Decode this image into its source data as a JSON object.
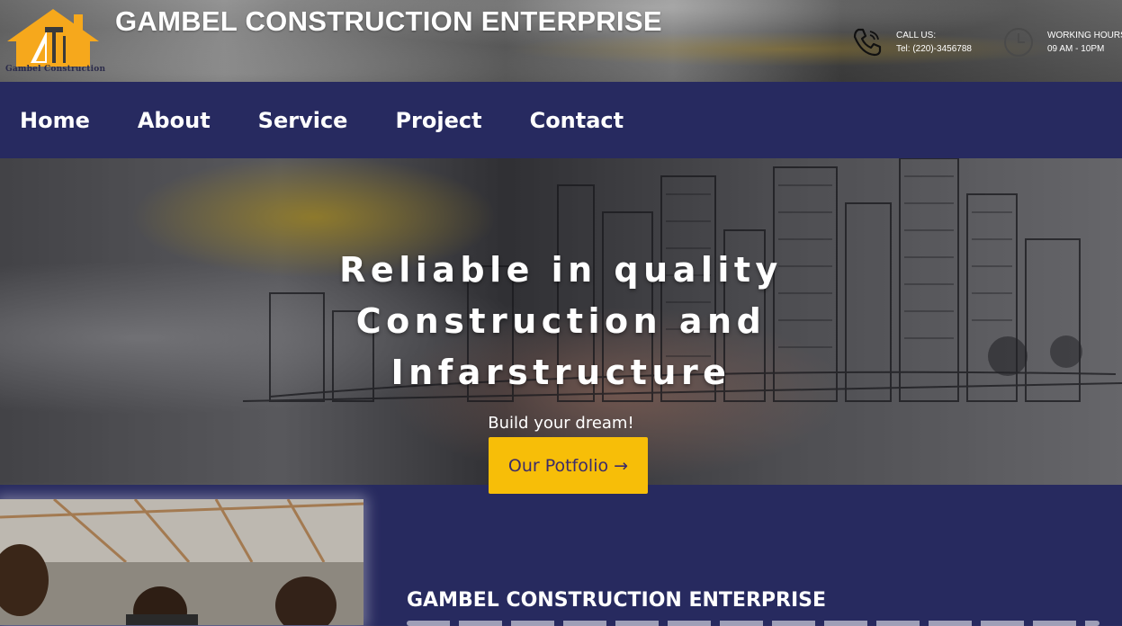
{
  "header": {
    "logo_caption": "Gambel Construction",
    "brand_title": "GAMBEL CONSTRUCTION ENTERPRISE",
    "call": {
      "label": "CALL US:",
      "value": "Tel: (220)-3456788",
      "icon": "phone-icon"
    },
    "hours": {
      "label": "WORKING HOURS",
      "value": "09 AM - 10PM",
      "icon": "clock-icon"
    }
  },
  "nav": {
    "items": [
      {
        "label": "Home"
      },
      {
        "label": "About"
      },
      {
        "label": "Service"
      },
      {
        "label": "Project"
      },
      {
        "label": "Contact"
      }
    ]
  },
  "hero": {
    "headline_lines": [
      "Reliable in quality",
      "Construction and",
      "Infarstructure"
    ],
    "subline": "Build your dream!",
    "cta_label": "Our Potfolio →"
  },
  "about": {
    "title": "GAMBEL CONSTRUCTION ENTERPRISE"
  },
  "colors": {
    "nav_bg": "#272a60",
    "accent": "#f7be08",
    "cta_text": "#3b2b6a"
  }
}
